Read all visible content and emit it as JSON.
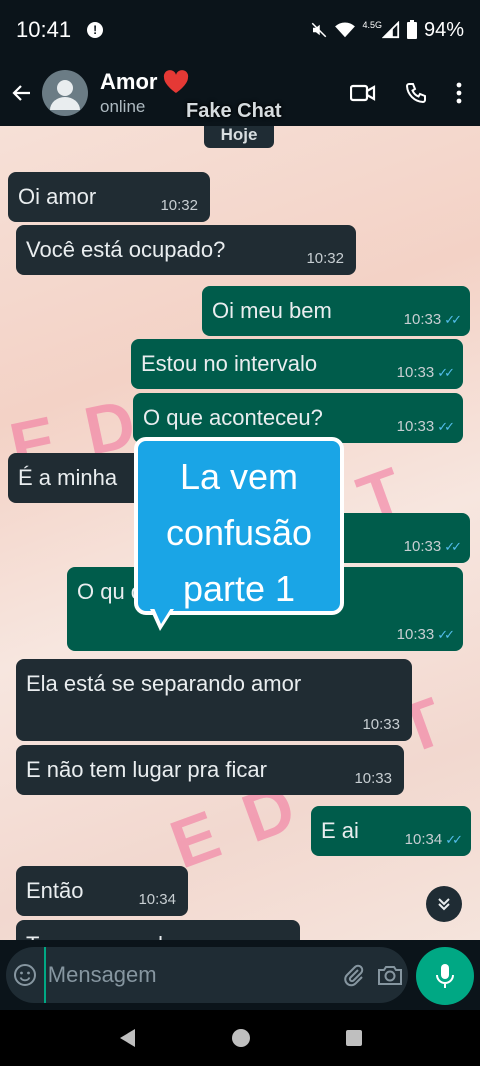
{
  "status_bar": {
    "time": "10:41",
    "network": "4.5G",
    "battery": "94%"
  },
  "header": {
    "name": "Amor",
    "status": "online",
    "overlay": "Fake Chat"
  },
  "date_chip": "Hoje",
  "watermark": {
    "top": "E D",
    "bottom": "E D",
    "right_top": "T",
    "right_bottom": "T"
  },
  "messages": [
    {
      "dir": "in",
      "text": "Oi amor",
      "time": "10:32"
    },
    {
      "dir": "in",
      "text": "Você está ocupado?",
      "time": "10:32"
    },
    {
      "dir": "out",
      "text": "Oi meu bem",
      "time": "10:33"
    },
    {
      "dir": "out",
      "text": "Estou no intervalo",
      "time": "10:33"
    },
    {
      "dir": "out",
      "text": "O que aconteceu?",
      "time": "10:33"
    },
    {
      "dir": "in",
      "text": "É a minha",
      "time": ""
    },
    {
      "dir": "out",
      "text": "m",
      "time": "10:33"
    },
    {
      "dir": "out",
      "text": "O qu                               ora?",
      "time": "10:33"
    },
    {
      "dir": "in",
      "text": "Ela está se separando amor",
      "time": "10:33"
    },
    {
      "dir": "in",
      "text": "E não tem lugar pra ficar",
      "time": "10:33"
    },
    {
      "dir": "out",
      "text": "E ai",
      "time": "10:34"
    },
    {
      "dir": "in",
      "text": "Então",
      "time": "10:34"
    },
    {
      "dir": "in",
      "text": "Tava pensando",
      "time": ""
    }
  ],
  "sticker": {
    "line1": "La vem",
    "line2": "confusão",
    "line3": "parte 1"
  },
  "input": {
    "placeholder": "Mensagem"
  },
  "colors": {
    "header_bg": "#0b141a",
    "incoming": "#202c33",
    "outgoing": "#005c4b",
    "accent": "#00a884",
    "ticks": "#53bdeb",
    "sticker": "#1aa5e6",
    "watermark": "#f2709c"
  }
}
